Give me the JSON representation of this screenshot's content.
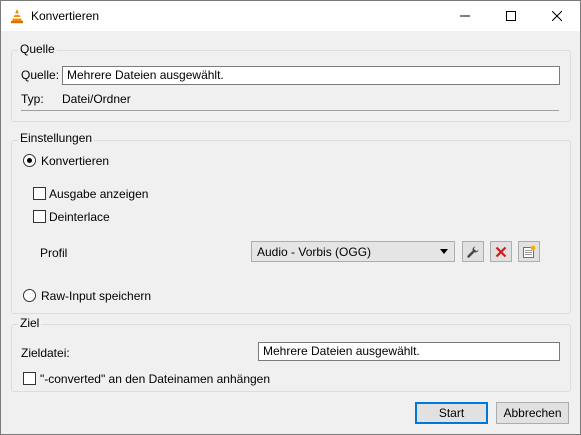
{
  "window": {
    "title": "Konvertieren"
  },
  "source": {
    "group_title": "Quelle",
    "label": "Quelle:",
    "value": "Mehrere Dateien ausgewählt.",
    "type_label": "Typ:",
    "type_value": "Datei/Ordner"
  },
  "settings": {
    "group_title": "Einstellungen",
    "convert_label": "Konvertieren",
    "convert_selected": true,
    "show_output_label": "Ausgabe anzeigen",
    "show_output_checked": false,
    "deinterlace_label": "Deinterlace",
    "deinterlace_checked": false,
    "profile_label": "Profil",
    "profile_value": "Audio - Vorbis (OGG)",
    "raw_input_label": "Raw-Input speichern",
    "raw_input_selected": false
  },
  "destination": {
    "group_title": "Ziel",
    "file_label": "Zieldatei:",
    "file_value": "Mehrere Dateien ausgewählt.",
    "append_label": "\"-converted\" an den Dateinamen anhängen",
    "append_checked": false
  },
  "buttons": {
    "start": "Start",
    "cancel": "Abbrechen"
  }
}
